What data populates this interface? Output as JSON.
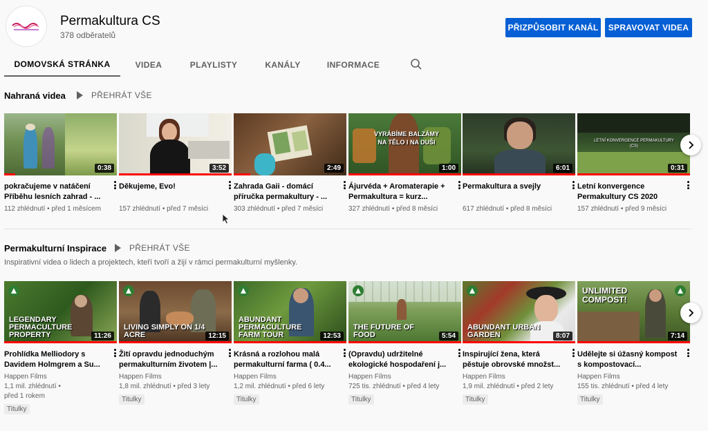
{
  "channel": {
    "name": "Permakultura CS",
    "subscribers": "378 odběratelů",
    "customize_label": "PŘIZPŮSOBIT KANÁL",
    "manage_label": "SPRAVOVAT VIDEA"
  },
  "tabs": [
    {
      "label": "DOMOVSKÁ STRÁNKA",
      "active": true
    },
    {
      "label": "VIDEA"
    },
    {
      "label": "PLAYLISTY"
    },
    {
      "label": "KANÁLY"
    },
    {
      "label": "INFORMACE"
    }
  ],
  "icons": {
    "search": "search-icon",
    "next": "chevron-right-icon",
    "more": "more-vert-icon"
  },
  "colors": {
    "accent": "#065fd4",
    "progress": "#ff0000",
    "badge": "#2e7d32"
  },
  "shelves": [
    {
      "title": "Nahraná videa",
      "play_all": "PŘEHRÁT VŠE",
      "videos": [
        {
          "title": "pokračujeme v natáčení Příběhu lesních zahrad - ...",
          "views": "112 zhlédnutí",
          "age": "před 1 měsícem",
          "duration": "0:38",
          "watched": 0.1
        },
        {
          "title": "Děkujeme, Evo!",
          "views": "157 zhlédnutí",
          "age": "před 7 měsíci",
          "duration": "3:52",
          "watched": 1.0
        },
        {
          "title": "Zahrada Gaii - domácí příručka permakultury - ...",
          "views": "303 zhlédnutí",
          "age": "před 7 měsíci",
          "duration": "2:49",
          "watched": 0.15
        },
        {
          "title": "Ájurvéda + Aromaterapie + Permakultura = kurz...",
          "views": "327 zhlédnutí",
          "age": "před 8 měsíci",
          "duration": "1:00",
          "watched": 1.0,
          "overlay": "VYRÁBÍME BALZÁMY NA TĚLO I NA DUŠI"
        },
        {
          "title": "Permakultura a svejly",
          "views": "617 zhlédnutí",
          "age": "před 8 měsíci",
          "duration": "6:01",
          "watched": 1.0
        },
        {
          "title": "Letní konvergence Permakultury CS 2020",
          "views": "157 zhlédnutí",
          "age": "před 9 měsíci",
          "duration": "0:31",
          "watched": 1.0,
          "overlay": "LETNÍ KONVERGENCE PERMAKULTURY (CS)"
        }
      ]
    },
    {
      "title": "Permakulturní Inspirace",
      "play_all": "PŘEHRÁT VŠE",
      "description": "Inspirativní videa o lidech a projektech, kteří tvoří a žijí v rámci permakulturní myšlenky.",
      "videos": [
        {
          "title": "Prohlídka Melliodory s Davidem Holmgrem a Su...",
          "channel": "Happen Films",
          "views": "1,1 mil. zhlédnutí •",
          "age": "před 1 rokem",
          "duration": "11:26",
          "tag": "Titulky",
          "overlay": "LEGENDARY PERMACULTURE PROPERTY",
          "watched": 1.0
        },
        {
          "title": "Žití opravdu jednoduchým permakulturním životem |...",
          "channel": "Happen Films",
          "views": "1,8 mil. zhlédnutí",
          "age": "před 3 lety",
          "duration": "12:15",
          "tag": "Titulky",
          "overlay": "LIVING SIMPLY ON 1/4 ACRE",
          "watched": 1.0
        },
        {
          "title": "Krásná a rozlohou malá permakulturní farma ( 0.4...",
          "channel": "Happen Films",
          "views": "1,2 mil. zhlédnutí",
          "age": "před 6 lety",
          "duration": "12:53",
          "tag": "Titulky",
          "overlay": "ABUNDANT PERMACULTURE FARM TOUR",
          "watched": 1.0
        },
        {
          "title": "(Opravdu) udržitelné ekologické hospodaření j...",
          "channel": "Happen Films",
          "views": "725 tis. zhlédnutí",
          "age": "před 4 lety",
          "duration": "5:54",
          "tag": "Titulky",
          "overlay": "THE FUTURE OF FOOD",
          "watched": 1.0
        },
        {
          "title": "Inspirující žena, která pěstuje obrovské množst...",
          "channel": "Happen Films",
          "views": "1,9 mil. zhlédnutí",
          "age": "před 2 lety",
          "duration": "8:07",
          "tag": "Titulky",
          "overlay": "ABUNDANT URBAN GARDEN",
          "watched": 1.0
        },
        {
          "title": "Udělejte si úžasný kompost s kompostovací...",
          "channel": "Happen Films",
          "views": "155 tis. zhlédnutí",
          "age": "před 4 lety",
          "duration": "7:14",
          "tag": "Titulky",
          "overlay": "UNLIMITED COMPOST!",
          "watched": 1.0
        }
      ]
    }
  ]
}
